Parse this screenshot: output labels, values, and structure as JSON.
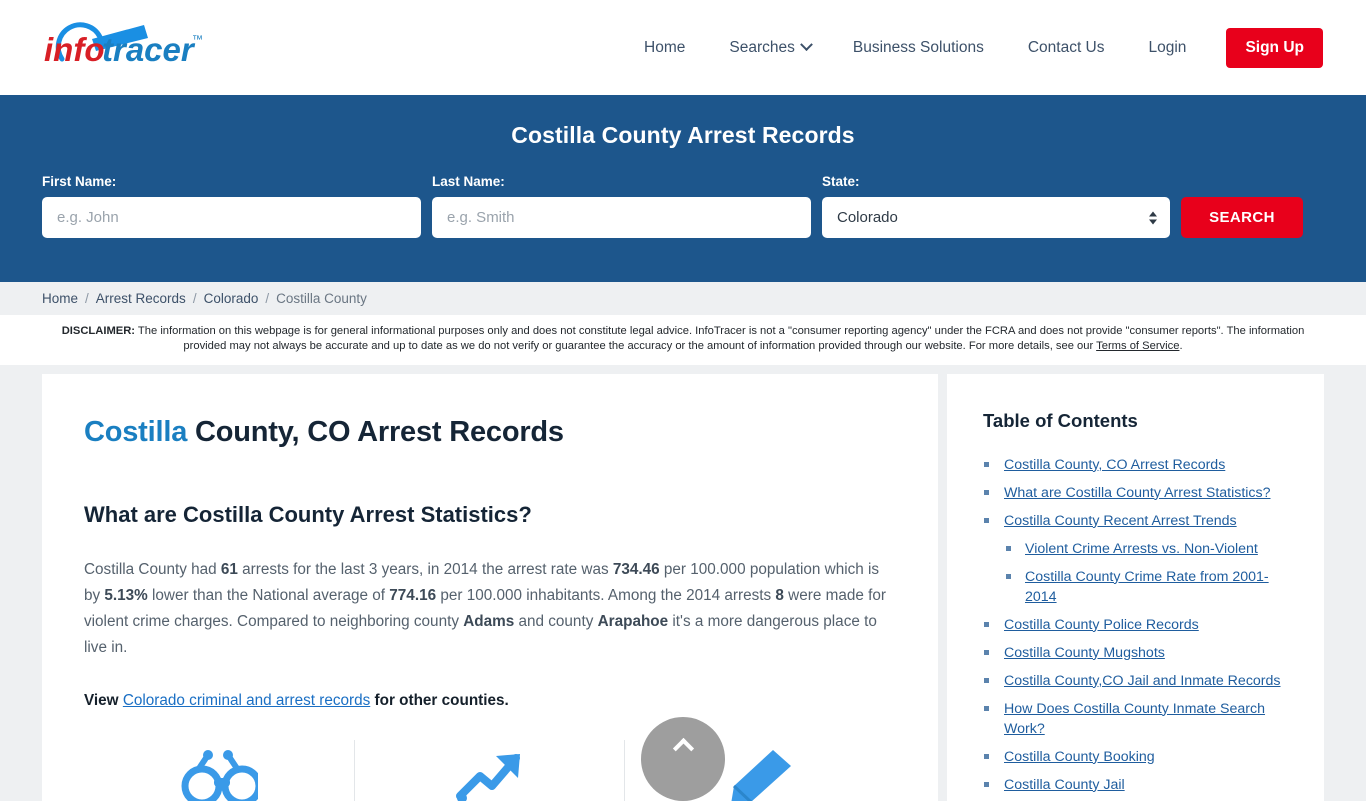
{
  "header": {
    "logo": {
      "part1": "info",
      "part2": "tracer",
      "tm": "™",
      "name": "infotracer-logo"
    },
    "nav": [
      {
        "label": "Home",
        "caret": false
      },
      {
        "label": "Searches",
        "caret": true
      },
      {
        "label": "Business Solutions",
        "caret": false
      },
      {
        "label": "Contact Us",
        "caret": false
      },
      {
        "label": "Login",
        "caret": false
      }
    ],
    "signup_label": "Sign Up"
  },
  "banner": {
    "title": "Costilla County Arrest Records",
    "first_name_label": "First Name:",
    "first_name_placeholder": "e.g. John",
    "first_name_value": "",
    "last_name_label": "Last Name:",
    "last_name_placeholder": "e.g. Smith",
    "last_name_value": "",
    "state_label": "State:",
    "state_selected": "Colorado",
    "state_options": [
      "Colorado"
    ],
    "search_label": "SEARCH",
    "bg_color": "#1d568c",
    "accent_color": "#e8001b"
  },
  "breadcrumb": {
    "items": [
      "Home",
      "Arrest Records",
      "Colorado"
    ],
    "current": "Costilla County",
    "separator": "/"
  },
  "disclaimer": {
    "label": "DISCLAIMER:",
    "text": " The information on this webpage is for general informational purposes only and does not constitute legal advice. InfoTracer is not a \"consumer reporting agency\" under the FCRA and does not provide \"consumer reports\". The information provided may not always be accurate and up to date as we do not verify or guarantee the accuracy or the amount of information provided through our website. For more details, see our ",
    "link_text": "Terms of Service",
    "tail": "."
  },
  "main": {
    "title_accent": "Costilla",
    "title_rest": " County, CO Arrest Records",
    "section_heading": "What are Costilla County Arrest Statistics?",
    "stats_paragraph": {
      "s1": "Costilla County had ",
      "b1": "61",
      "s2": " arrests for the last 3 years, in 2014 the arrest rate was ",
      "b2": "734.46",
      "s3": " per 100.000 population which is by ",
      "b3": "5.13%",
      "s4": " lower than the National average of ",
      "b4": "774.16",
      "s5": " per 100.000 inhabitants. Among the 2014 arrests ",
      "b5": "8",
      "s6": " were made for violent crime charges. Compared to neighboring county ",
      "b6": "Adams",
      "s7": " and county ",
      "b7": "Arapahoe",
      "s8": " it's a more dangerous place to live in."
    },
    "view_line": {
      "prefix": "View ",
      "link": "Colorado criminal and arrest records",
      "suffix": " for other counties."
    },
    "icons": [
      {
        "name": "handcuffs-icon"
      },
      {
        "name": "trend-arrow-icon"
      },
      {
        "name": "pen-icon"
      }
    ]
  },
  "toc": {
    "title": "Table of Contents",
    "items": [
      {
        "label": "Costilla County, CO Arrest Records"
      },
      {
        "label": "What are Costilla County Arrest Statistics?"
      },
      {
        "label": "Costilla County Recent Arrest Trends",
        "children": [
          {
            "label": "Violent Crime Arrests vs. Non-Violent"
          },
          {
            "label": "Costilla County Crime Rate from 2001-2014"
          }
        ]
      },
      {
        "label": "Costilla County Police Records"
      },
      {
        "label": "Costilla County Mugshots"
      },
      {
        "label": "Costilla County,CO Jail and Inmate Records"
      },
      {
        "label": "How Does Costilla County Inmate Search Work?"
      },
      {
        "label": "Costilla County Booking"
      },
      {
        "label": "Costilla County Jail"
      }
    ]
  },
  "scroll_top": {
    "name": "scroll-to-top-button"
  }
}
